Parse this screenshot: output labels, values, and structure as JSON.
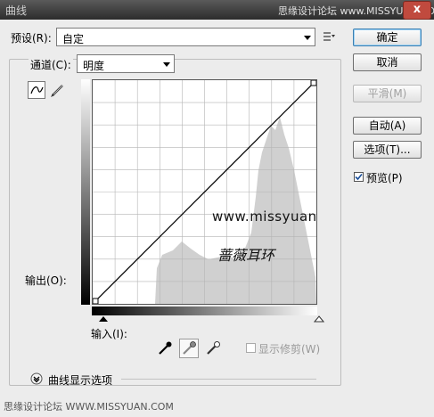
{
  "window": {
    "title": "曲线",
    "close_label": "x"
  },
  "watermark_top": "思缘设计论坛 www.MISSYUAN.COM",
  "preset": {
    "label": "预设(R):",
    "value": "自定",
    "menu_icon": "preset-options-icon"
  },
  "channel": {
    "label": "通道(C):",
    "value": "明度"
  },
  "graph": {
    "output_label": "输出(O):",
    "input_label": "输入(I):",
    "grid_divisions": 10,
    "curve_points": [
      [
        0,
        0
      ],
      [
        255,
        255
      ]
    ],
    "watermark_url": "www.missyuan.com",
    "watermark_text": "蔷薇耳环",
    "histogram_color": "#d0d0d0"
  },
  "buttons": {
    "ok": "确定",
    "cancel": "取消",
    "smooth": "平滑(M)",
    "auto": "自动(A)",
    "options": "选项(T)..."
  },
  "preview": {
    "label": "预览(P)",
    "checked": true
  },
  "show_clipping": {
    "label": "显示修剪(W)",
    "checked": false
  },
  "curve_display_options": "曲线显示选项",
  "watermark_bottom": "思缘设计论坛 WWW.MISSYUAN.COM",
  "colors": {
    "title_bar": "#3c3c3c",
    "accent": "#3c7fb1",
    "dialog_bg": "#ececec"
  }
}
